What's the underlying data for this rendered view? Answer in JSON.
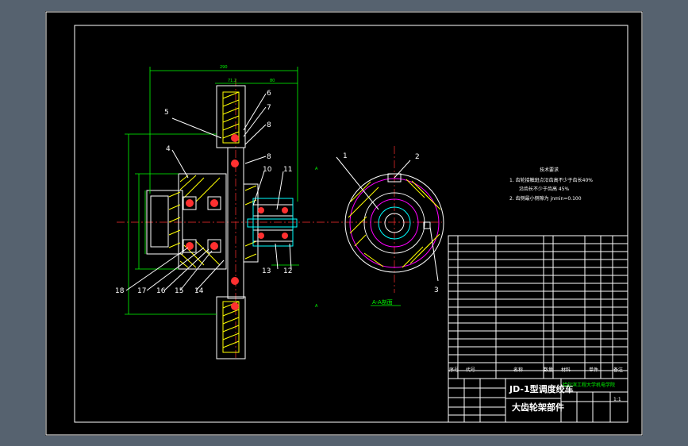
{
  "colors": {
    "background": "#56626f",
    "sheet": "#000000",
    "line": "#ffffff",
    "hatch": "#ffff00",
    "dimension": "#00ff00",
    "shaft": "#00ffff",
    "gear_circle": "#ff00ff",
    "centerline": "#ff3030"
  },
  "balloons": {
    "b1": "1",
    "b2": "2",
    "b3": "3",
    "b4": "4",
    "b5": "5",
    "b6": "6",
    "b7": "7",
    "b8a": "8",
    "b8b": "8",
    "b10": "10",
    "b11": "11",
    "b12": "12",
    "b13": "13",
    "b14": "14",
    "b15": "15",
    "b16": "16",
    "b17": "17",
    "b18": "18"
  },
  "section_label": "A-A剖面",
  "section_mark": "A",
  "tech_req": {
    "title": "技术要求",
    "line1": "1. 齿轮接触斑点沿齿高不少于齿长40%",
    "line2": "沿齿长不少于齿高 45%",
    "line3": "2. 齿侧最小侧隙为 jnmin=0.100"
  },
  "title_block": {
    "product": "JD-1型调度绞车",
    "part": "大齿轮架部件",
    "school": "哈尔滨工程大学机电学院",
    "scale": "1:1",
    "col_seq": "序号",
    "col_code": "代号",
    "col_name": "名称",
    "col_qty": "数量",
    "col_material": "材料",
    "col_weight": "单件",
    "col_note": "备注"
  }
}
